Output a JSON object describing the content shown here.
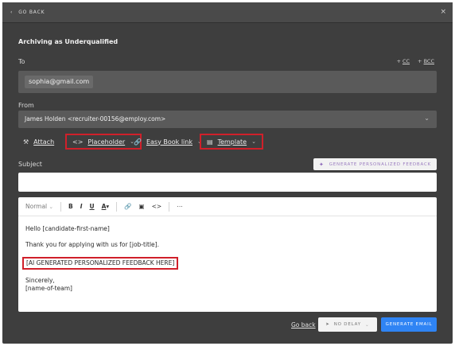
{
  "topbar": {
    "back_label": "GO BACK",
    "back_icon": "chevron-left-icon",
    "close_icon": "close-icon"
  },
  "title": "Archiving as Underqualified",
  "to": {
    "label": "To",
    "cc_label": "CC",
    "bcc_label": "BCC",
    "recipient": "sophia@gmail.com"
  },
  "from": {
    "label": "From",
    "value": "James Holden <recruiter-00156@employ.com>"
  },
  "toolbar": {
    "attach": "Attach",
    "placeholder": "Placeholder",
    "easy_book": "Easy Book link",
    "template": "Template"
  },
  "subject": {
    "label": "Subject",
    "value": "",
    "ai_button": "GENERATE PERSONALIZED FEEDBACK"
  },
  "editor": {
    "style_select": "Normal",
    "lines": [
      "Hello [candidate-first-name]",
      "Thank you for applying with us for [job-title].",
      "[AI GENERATED PERSONALIZED FEEDBACK HERE]",
      "Sincerely,",
      "[name-of-team]"
    ]
  },
  "footer": {
    "go_back": "Go back",
    "delay": "NO DELAY",
    "generate": "GENERATE EMAIL"
  },
  "colors": {
    "frame_bg": "#3e3e3e",
    "input_bg": "#5a5a5a",
    "highlight_red": "#d0202a",
    "primary_blue": "#2f84f4",
    "ai_purple": "#9a7cc0"
  }
}
